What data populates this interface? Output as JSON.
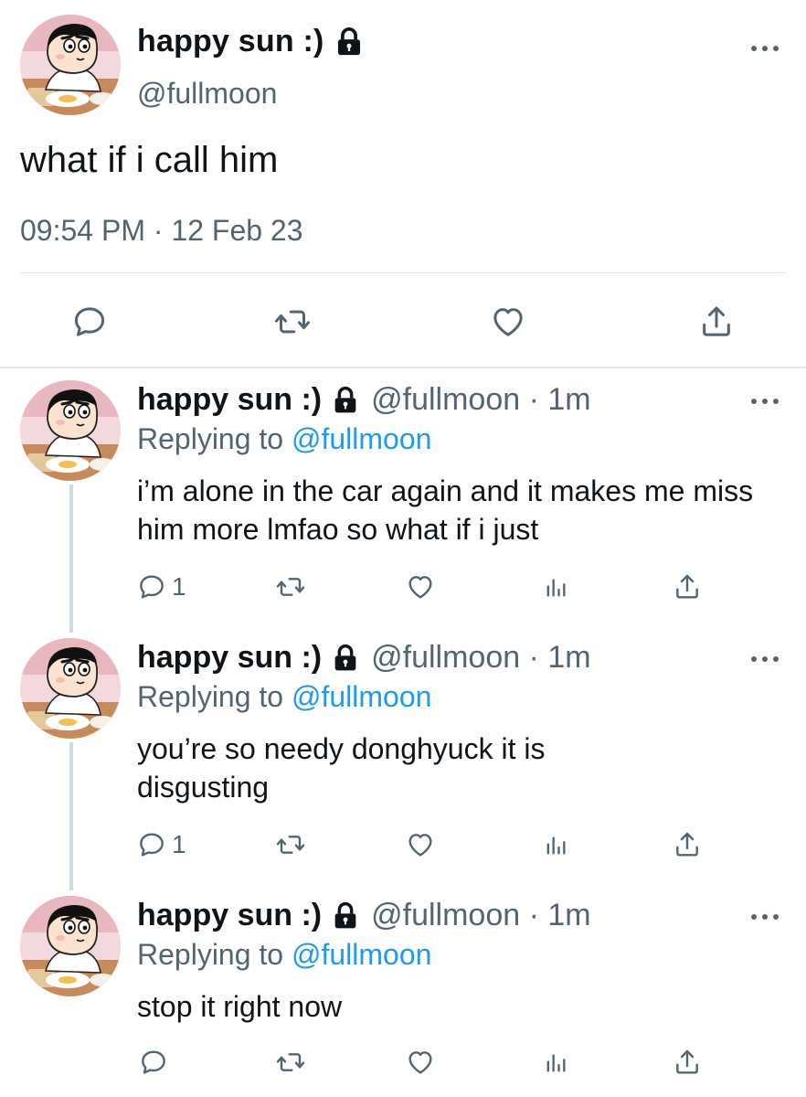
{
  "main_tweet": {
    "display_name": "happy sun :)",
    "handle": "@fullmoon",
    "text": "what if i call him",
    "timestamp": "09:54 PM · 12 Feb 23",
    "icons": [
      "lock-icon",
      "more-icon",
      "reply-icon",
      "retweet-icon",
      "like-icon",
      "share-icon"
    ]
  },
  "replies": [
    {
      "display_name": "happy sun :)",
      "handle_time": "@fullmoon · 1m",
      "replying_prefix": "Replying to ",
      "replying_to": "@fullmoon",
      "text": "i’m alone in the car again and it makes me miss him more lmfao so what if i just",
      "reply_count": "1"
    },
    {
      "display_name": "happy sun :)",
      "handle_time": "@fullmoon · 1m",
      "replying_prefix": "Replying to ",
      "replying_to": "@fullmoon",
      "text": "you’re so needy donghyuck it is disgusting",
      "reply_count": "1"
    },
    {
      "display_name": "happy sun :)",
      "handle_time": "@fullmoon · 1m",
      "replying_prefix": "Replying to ",
      "replying_to": "@fullmoon",
      "text": "stop it right now",
      "reply_count": ""
    }
  ],
  "colors": {
    "text": "#0f1419",
    "secondary": "#536471",
    "link": "#1d9bf0",
    "divider": "#dfe3e7"
  }
}
